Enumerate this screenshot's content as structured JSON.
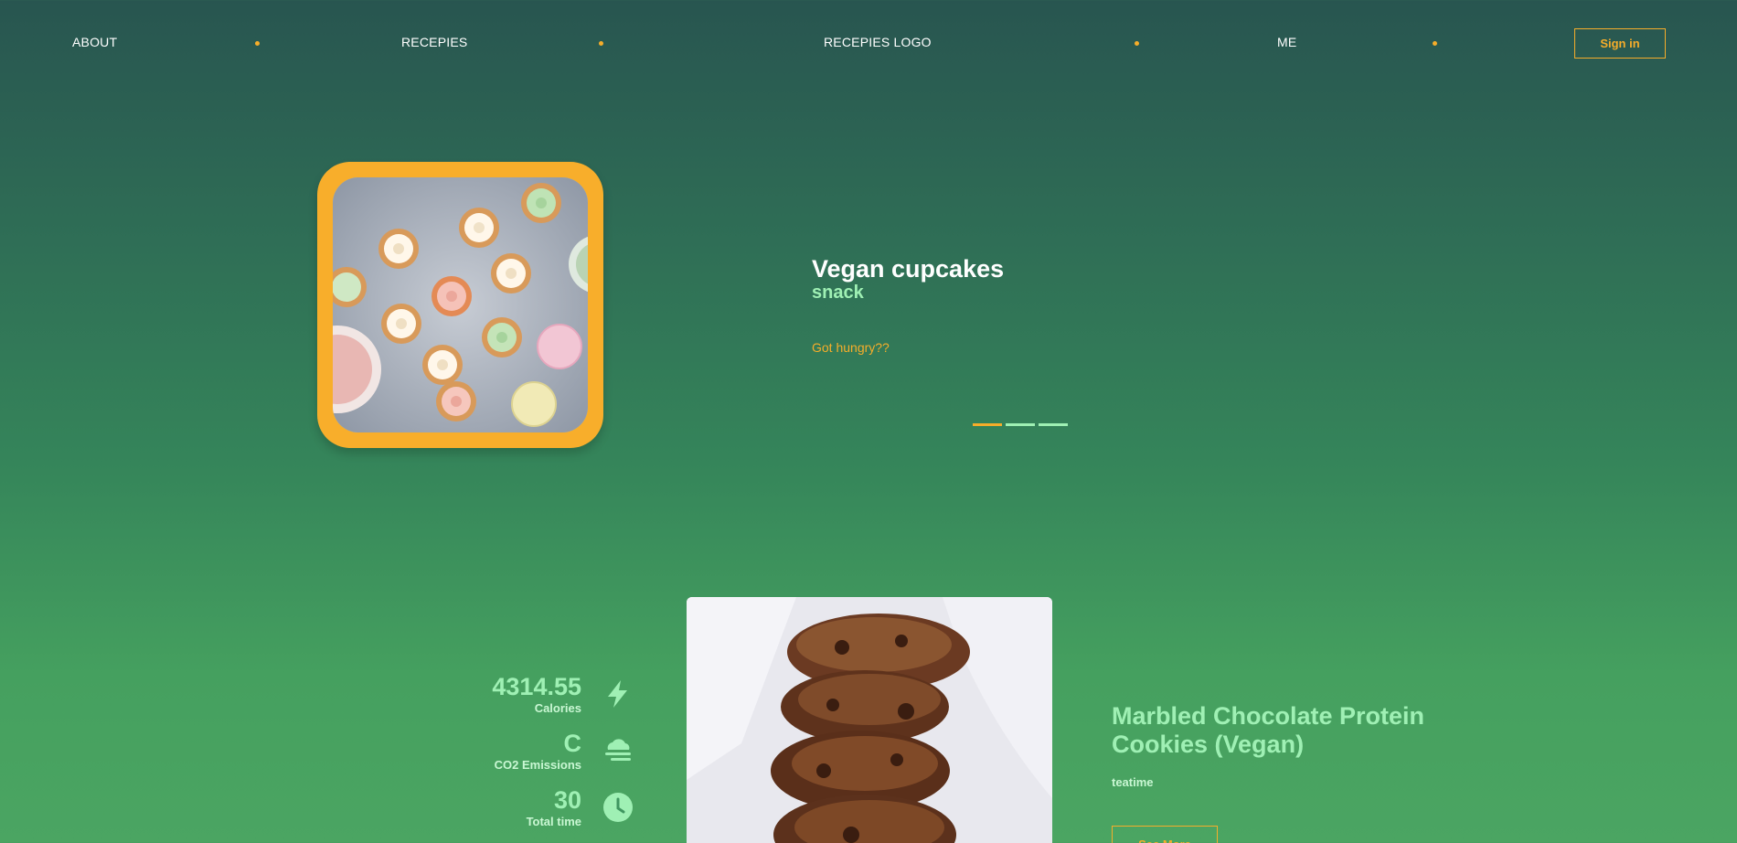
{
  "nav": {
    "about": "ABOUT",
    "recipes": "RECEPIES",
    "logo": "RECEPIES LOGO",
    "me": "ME",
    "signin": "Sign in"
  },
  "hero": {
    "title": "Vegan cupcakes",
    "category": "snack",
    "tagline": "Got hungry??",
    "slides": [
      {
        "active": true
      },
      {
        "active": false
      },
      {
        "active": false
      }
    ]
  },
  "featured": {
    "stats": [
      {
        "value": "4314.55",
        "label": "Calories",
        "icon": "lightning-icon"
      },
      {
        "value": "C",
        "label": "CO2 Emissions",
        "icon": "cloud-icon"
      },
      {
        "value": "30",
        "label": "Total time",
        "icon": "clock-icon"
      }
    ],
    "title": "Marbled Chocolate Protein Cookies (Vegan)",
    "category": "teatime",
    "button": "See More"
  },
  "colors": {
    "accent": "#f6ad2a",
    "mint": "#9ff0b4",
    "inactive_slide": "#9ff0b4"
  }
}
